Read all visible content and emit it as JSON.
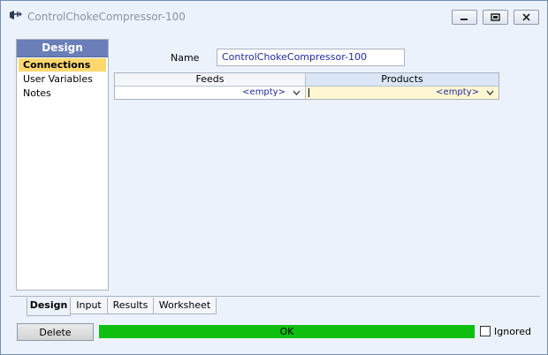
{
  "window": {
    "title": "ControlChokeCompressor-100",
    "icons": {
      "app": "compressor-icon",
      "minimize": "minimize-icon",
      "restore": "restore-icon",
      "close": "close-icon"
    }
  },
  "nav": {
    "header": "Design",
    "items": [
      {
        "label": "Connections",
        "active": true
      },
      {
        "label": "User Variables",
        "active": false
      },
      {
        "label": "Notes",
        "active": false
      }
    ]
  },
  "form": {
    "name_label": "Name",
    "name_value": "ControlChokeCompressor-100"
  },
  "connections": {
    "headers": {
      "feeds": "Feeds",
      "products": "Products"
    },
    "feeds_value": "<empty>",
    "products_value": "<empty>"
  },
  "tabs": [
    {
      "label": "Design",
      "active": true
    },
    {
      "label": "Input",
      "active": false
    },
    {
      "label": "Results",
      "active": false
    },
    {
      "label": "Worksheet",
      "active": false
    }
  ],
  "footer": {
    "delete_label": "Delete",
    "status_text": "OK",
    "ignored_label": "Ignored",
    "ignored_checked": false
  },
  "colors": {
    "status_ok": "#10c010",
    "nav_header": "#6a7fb8",
    "nav_active": "#fdd86e",
    "products_cell": "#fff7d2"
  }
}
